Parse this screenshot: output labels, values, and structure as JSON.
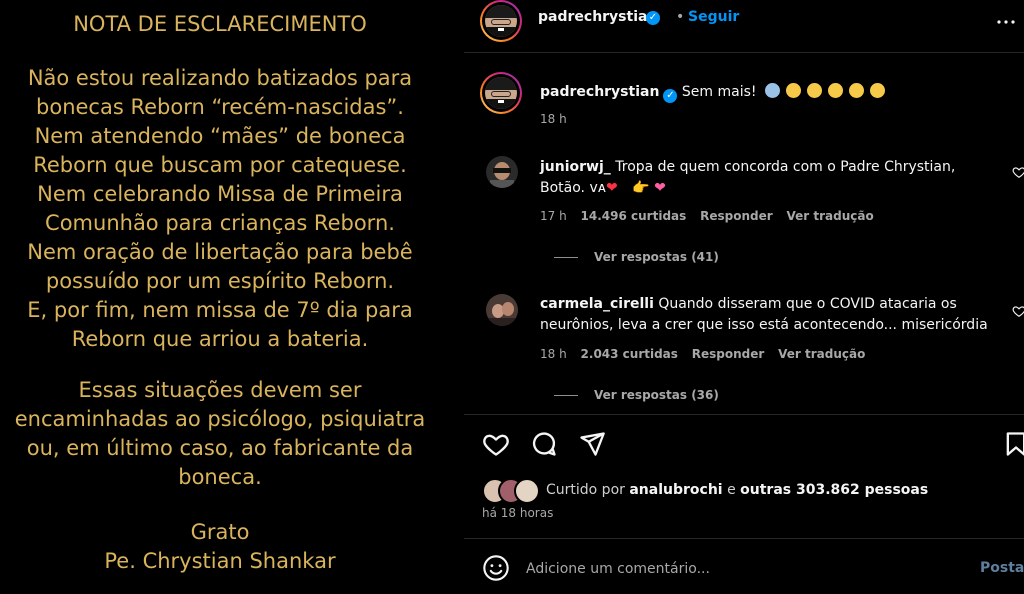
{
  "post_image": {
    "title": "NOTA DE ESCLARECIMENTO",
    "paragraph1": [
      "Não estou realizando batizados para",
      "bonecas Reborn “recém-nascidas”.",
      "Nem atendendo “mães” de boneca",
      "Reborn que buscam por catequese.",
      "Nem celebrando Missa de Primeira",
      "Comunhão para crianças Reborn.",
      "Nem oração de libertação para bebê",
      "possuído por um espírito Reborn.",
      "E, por fim, nem missa de 7º dia para",
      "Reborn que arriou a bateria."
    ],
    "paragraph2": [
      "Essas situações devem ser",
      "encaminhadas ao psicólogo, psiquiatra",
      "ou, em último caso, ao fabricante da",
      "boneca."
    ],
    "closing": [
      "Grato",
      "Pe. Chrystian Shankar"
    ]
  },
  "header": {
    "username": "padrechrystian",
    "separator": "•",
    "follow_label": "Seguir",
    "more_icon": "more-horizontal-icon"
  },
  "caption": {
    "username": "padrechrystian",
    "text": "Sem mais!",
    "time": "18 h"
  },
  "comments": [
    {
      "username": "juniorwj_",
      "text_line1": "Tropa de quem concorda com o Padre Chrystian,",
      "text_line2": "Botão. vᴀ",
      "time": "17 h",
      "likes": "14.496 curtidas",
      "reply_label": "Responder",
      "translate_label": "Ver tradução",
      "view_replies": "Ver respostas (41)"
    },
    {
      "username": "carmela_cirelli",
      "text_line1": "Quando disseram que o COVID atacaria os",
      "text_line2": "neurônios, leva a crer que isso está acontecendo... misericórdia",
      "time": "18 h",
      "likes": "2.043 curtidas",
      "reply_label": "Responder",
      "translate_label": "Ver tradução",
      "view_replies": "Ver respostas (36)"
    }
  ],
  "likes": {
    "prefix": "Curtido por",
    "user": "analubrochi",
    "middle": "e",
    "others": "outras 303.862 pessoas",
    "time": "há 18 horas"
  },
  "add_comment": {
    "placeholder": "Adicione um comentário...",
    "post_label": "Postar"
  },
  "colors": {
    "note_gold": "#d9b45c",
    "link_blue": "#0095f6",
    "heart_red": "#ff3040"
  }
}
